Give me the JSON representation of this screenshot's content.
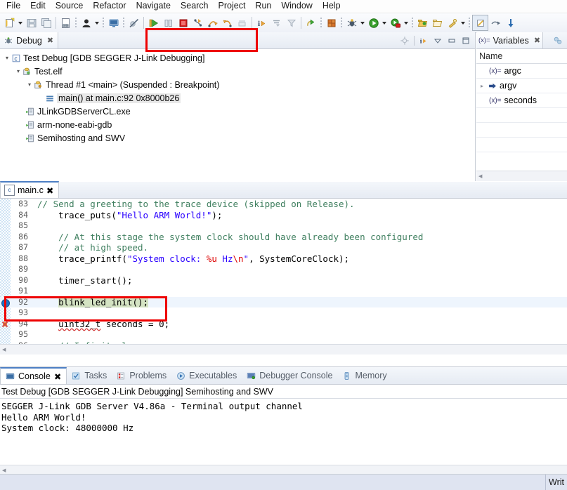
{
  "menu": {
    "items": [
      "File",
      "Edit",
      "Source",
      "Refactor",
      "Navigate",
      "Search",
      "Project",
      "Run",
      "Window",
      "Help"
    ]
  },
  "toolbar": {
    "buttons": [
      {
        "name": "new-wizard",
        "title": "New"
      },
      {
        "name": "new-dropdown",
        "title": "New menu"
      },
      {
        "name": "save",
        "title": "Save"
      },
      {
        "name": "save-all",
        "title": "Save All"
      },
      {
        "name": "build-all",
        "title": "Build All"
      },
      {
        "name": "user-profile",
        "title": "Manage Configurations"
      },
      {
        "name": "user-dropdown",
        "title": "Manage Configurations menu"
      },
      {
        "name": "open-console",
        "title": "Open Console"
      },
      {
        "name": "skip-breakpoints",
        "title": "Skip All Breakpoints"
      },
      {
        "name": "resume",
        "title": "Resume"
      },
      {
        "name": "suspend",
        "title": "Suspend"
      },
      {
        "name": "terminate",
        "title": "Terminate"
      },
      {
        "name": "step-into",
        "title": "Step Into"
      },
      {
        "name": "step-over",
        "title": "Step Over"
      },
      {
        "name": "step-return",
        "title": "Step Return"
      },
      {
        "name": "instruction-stepping",
        "title": "Instruction Stepping Mode"
      },
      {
        "name": "show-info",
        "title": "Show Source"
      },
      {
        "name": "collapse-frames",
        "title": "Collapse"
      },
      {
        "name": "filter",
        "title": "Filter"
      },
      {
        "name": "restore-perspective",
        "title": "Restore"
      },
      {
        "name": "build-config",
        "title": "Build Configuration"
      },
      {
        "name": "debug",
        "title": "Debug"
      },
      {
        "name": "debug-dropdown",
        "title": "Debug menu"
      },
      {
        "name": "run",
        "title": "Run"
      },
      {
        "name": "run-dropdown",
        "title": "Run menu"
      },
      {
        "name": "external-tools",
        "title": "External Tools"
      },
      {
        "name": "external-tools-dropdown",
        "title": "External Tools menu"
      },
      {
        "name": "open-type",
        "title": "Open Type"
      },
      {
        "name": "open-folder",
        "title": "Open Element"
      },
      {
        "name": "search",
        "title": "Search"
      },
      {
        "name": "search-dropdown",
        "title": "Search menu"
      },
      {
        "name": "pin-editor",
        "title": "Pin Editor"
      },
      {
        "name": "next-annotation",
        "title": "Next Annotation"
      },
      {
        "name": "download",
        "title": "Download"
      }
    ]
  },
  "debug_view": {
    "tab_label": "Debug",
    "tab_close": "✖",
    "tree": [
      {
        "indent": 0,
        "expander": "▾",
        "icon": "launch-config-icon",
        "label": "Test Debug [GDB SEGGER J-Link Debugging]",
        "selected": false
      },
      {
        "indent": 1,
        "expander": "▾",
        "icon": "process-icon",
        "label": "Test.elf",
        "selected": false
      },
      {
        "indent": 2,
        "expander": "▾",
        "icon": "thread-icon",
        "label": "Thread #1 <main> (Suspended : Breakpoint)",
        "selected": false
      },
      {
        "indent": 3,
        "expander": "",
        "icon": "stackframe-icon",
        "label": "main() at main.c:92 0x8000b26",
        "selected": true
      },
      {
        "indent": 1,
        "expander": "",
        "icon": "process-exe-icon",
        "label": "JLinkGDBServerCL.exe",
        "selected": false
      },
      {
        "indent": 1,
        "expander": "",
        "icon": "process-exe-icon",
        "label": "arm-none-eabi-gdb",
        "selected": false
      },
      {
        "indent": 1,
        "expander": "",
        "icon": "process-exe-icon",
        "label": "Semihosting and SWV",
        "selected": false
      }
    ]
  },
  "variables_view": {
    "tab_label": "Variables",
    "tab_close": "✖",
    "column_header": "Name",
    "rows": [
      {
        "expander": "",
        "kind": "(x)=",
        "name": "argc"
      },
      {
        "expander": "▸",
        "kind": "pointer",
        "name": "argv"
      },
      {
        "expander": "",
        "kind": "(x)=",
        "name": "seconds"
      }
    ]
  },
  "editor": {
    "tab_label": "main.c",
    "tab_icon_letter": "c",
    "tab_close": "✖",
    "current_line": 92,
    "lines": [
      {
        "num": 83,
        "segments": [
          {
            "t": "    ",
            "c": ""
          },
          {
            "t": "// Send a greeting to the trace device (skipped on Release).",
            "c": "cm"
          }
        ]
      },
      {
        "num": 84,
        "segments": [
          {
            "t": "    trace_puts(",
            "c": ""
          },
          {
            "t": "\"Hello ARM World!\"",
            "c": "str"
          },
          {
            "t": ");",
            "c": ""
          }
        ]
      },
      {
        "num": 85,
        "segments": []
      },
      {
        "num": 86,
        "segments": [
          {
            "t": "    ",
            "c": ""
          },
          {
            "t": "// At this stage the system clock should have already been configured",
            "c": "cm"
          }
        ]
      },
      {
        "num": 87,
        "segments": [
          {
            "t": "    ",
            "c": ""
          },
          {
            "t": "// at high speed.",
            "c": "cm"
          }
        ]
      },
      {
        "num": 88,
        "segments": [
          {
            "t": "    trace_printf(",
            "c": ""
          },
          {
            "t": "\"System clock: ",
            "c": "str"
          },
          {
            "t": "%u",
            "c": "esc"
          },
          {
            "t": " Hz",
            "c": "str"
          },
          {
            "t": "\\n",
            "c": "esc"
          },
          {
            "t": "\"",
            "c": "str"
          },
          {
            "t": ", SystemCoreClock);",
            "c": ""
          }
        ]
      },
      {
        "num": 89,
        "segments": []
      },
      {
        "num": 90,
        "segments": [
          {
            "t": "    timer_start();",
            "c": ""
          }
        ]
      },
      {
        "num": 91,
        "segments": []
      },
      {
        "num": 92,
        "segments": [
          {
            "t": "    ",
            "c": ""
          },
          {
            "t": "blink_led_init();",
            "c": "hl"
          }
        ]
      },
      {
        "num": 93,
        "segments": []
      },
      {
        "num": 94,
        "segments": [
          {
            "t": "    ",
            "c": ""
          },
          {
            "t": "uint32_t",
            "c": "sq"
          },
          {
            "t": " seconds = 0;",
            "c": ""
          }
        ]
      },
      {
        "num": 95,
        "segments": []
      },
      {
        "num": 96,
        "segments": [
          {
            "t": "    ",
            "c": ""
          },
          {
            "t": "// Infinite loop",
            "c": "cm"
          }
        ]
      }
    ]
  },
  "console": {
    "tabs": [
      {
        "label": "Console",
        "icon": "console-icon",
        "active": true,
        "close": "✖"
      },
      {
        "label": "Tasks",
        "icon": "tasks-icon",
        "active": false
      },
      {
        "label": "Problems",
        "icon": "problems-icon",
        "active": false
      },
      {
        "label": "Executables",
        "icon": "executables-icon",
        "active": false
      },
      {
        "label": "Debugger Console",
        "icon": "debugger-console-icon",
        "active": false
      },
      {
        "label": "Memory",
        "icon": "memory-icon",
        "active": false
      }
    ],
    "title": "Test Debug [GDB SEGGER J-Link Debugging] Semihosting and SWV",
    "output": "SEGGER J-Link GDB Server V4.86a - Terminal output channel\nHello ARM World!\nSystem clock: 48000000 Hz"
  },
  "statusbar": {
    "right_text": "Writ"
  },
  "colors": {
    "annotation_red": "#ee0000",
    "current_line_highlight": "#eef5fd",
    "debug_statement_green": "#d4e3c3",
    "comment_green": "#3f7f5f",
    "string_blue": "#2a00ff",
    "escape_red": "#dd0000",
    "selection_gray": "#e8e8e8"
  }
}
